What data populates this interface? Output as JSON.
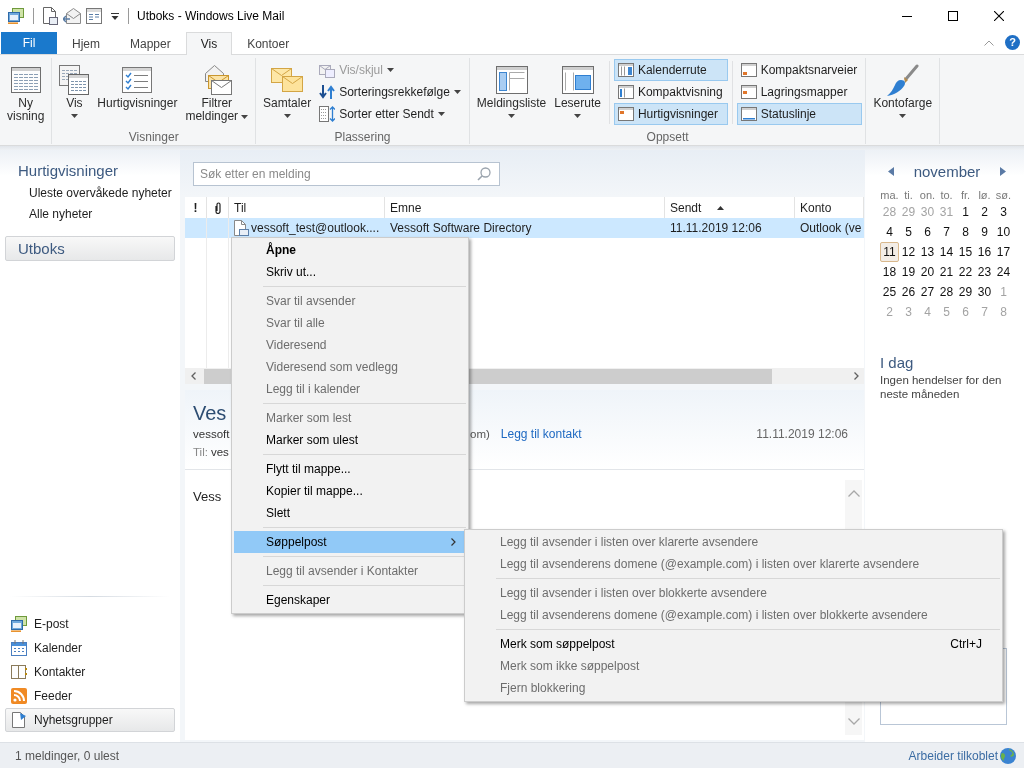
{
  "title_bar": {
    "title": "Utboks - Windows Live Mail"
  },
  "ribbon": {
    "tabs": [
      {
        "label": "Fil",
        "kind": "file",
        "selected": false
      },
      {
        "label": "Hjem",
        "kind": "tab",
        "selected": false
      },
      {
        "label": "Mapper",
        "kind": "tab",
        "selected": false
      },
      {
        "label": "Vis",
        "kind": "tab",
        "selected": true
      },
      {
        "label": "Kontoer",
        "kind": "tab",
        "selected": false
      }
    ],
    "help": "?",
    "groups": [
      {
        "buttons": [
          {
            "label": "Ny visning",
            "dropdown": false
          }
        ]
      },
      {
        "label": "Visninger",
        "buttons": [
          {
            "label": "Vis",
            "dropdown": true
          },
          {
            "label": "Hurtigvisninger",
            "dropdown": false
          },
          {
            "label": "Filtrer meldinger",
            "dropdown": true
          }
        ]
      },
      {
        "label": "Plassering",
        "buttons": [
          {
            "label": "Samtaler",
            "dropdown": true
          }
        ],
        "columns": [
          {
            "kind": "commands",
            "items": [
              {
                "label": "Vis/skjul",
                "dropdown": true,
                "disabled": true
              },
              {
                "label": "Sorteringsrekkefølge",
                "dropdown": true,
                "disabled": false
              },
              {
                "label": "Sorter etter Sendt",
                "dropdown": true,
                "disabled": false
              }
            ]
          }
        ]
      },
      {
        "label": "Oppsett",
        "buttons": [
          {
            "label": "Meldingsliste",
            "dropdown": true
          },
          {
            "label": "Leserute",
            "dropdown": true
          }
        ],
        "columns": [
          {
            "kind": "toggles",
            "items": [
              {
                "label": "Kalenderrute",
                "selected": true
              },
              {
                "label": "Kompaktvisning",
                "selected": false
              },
              {
                "label": "Hurtigvisninger",
                "selected": true
              }
            ]
          },
          {
            "kind": "toggles",
            "items": [
              {
                "label": "Kompaktsnarveier",
                "selected": false
              },
              {
                "label": "Lagringsmapper",
                "selected": false
              },
              {
                "label": "Statuslinje",
                "selected": true
              }
            ]
          }
        ]
      },
      {
        "buttons": [
          {
            "label": "Kontofarge",
            "dropdown": true
          }
        ]
      }
    ]
  },
  "sidebar": {
    "quick_views": {
      "title": "Hurtigvisninger",
      "items": [
        "Uleste overvåkede nyheter",
        "Alle nyheter"
      ]
    },
    "folders": [
      {
        "label": "Utboks",
        "selected": true
      }
    ],
    "nav": [
      {
        "label": "E-post",
        "selected": false
      },
      {
        "label": "Kalender",
        "selected": false
      },
      {
        "label": "Kontakter",
        "selected": false
      },
      {
        "label": "Feeder",
        "selected": false
      },
      {
        "label": "Nyhetsgrupper",
        "selected": true
      }
    ]
  },
  "search": {
    "placeholder": "Søk etter en melding"
  },
  "message_list": {
    "columns": [
      {
        "kind": "flag",
        "label": "!",
        "sorted": false
      },
      {
        "kind": "attachment",
        "sorted": false
      },
      {
        "kind": "text",
        "label": "Til",
        "sorted": false
      },
      {
        "kind": "text",
        "label": "Emne",
        "sorted": false
      },
      {
        "kind": "text",
        "label": "Sendt",
        "sorted": true
      },
      {
        "kind": "text",
        "label": "Konto",
        "sorted": false
      }
    ],
    "rows": [
      {
        "selected": true,
        "to": "vessoft_test@outlook....",
        "subject": "Vessoft Software Directory",
        "sent": "11.11.2019 12:06",
        "account": "Outlook (ve"
      }
    ]
  },
  "preview": {
    "subject": "Ves",
    "from": "vessoft",
    "from_end": "om)",
    "add_contact": "Legg til kontakt",
    "date": "11.11.2019 12:06",
    "to_label": "Til:",
    "to": "ves",
    "body": "Vess"
  },
  "calendar": {
    "month": "november",
    "weekdays": [
      "ma.",
      "ti.",
      "on.",
      "to.",
      "fr.",
      "lø.",
      "sø."
    ],
    "weeks": [
      [
        {
          "day": "28",
          "other_month": true,
          "selected": false
        },
        {
          "day": "29",
          "other_month": true,
          "selected": false
        },
        {
          "day": "30",
          "other_month": true,
          "selected": false
        },
        {
          "day": "31",
          "other_month": true,
          "selected": false
        },
        {
          "day": "1",
          "other_month": false,
          "selected": false
        },
        {
          "day": "2",
          "other_month": false,
          "selected": false
        },
        {
          "day": "3",
          "other_month": false,
          "selected": false
        }
      ],
      [
        {
          "day": "4",
          "other_month": false,
          "selected": false
        },
        {
          "day": "5",
          "other_month": false,
          "selected": false
        },
        {
          "day": "6",
          "other_month": false,
          "selected": false
        },
        {
          "day": "7",
          "other_month": false,
          "selected": false
        },
        {
          "day": "8",
          "other_month": false,
          "selected": false
        },
        {
          "day": "9",
          "other_month": false,
          "selected": false
        },
        {
          "day": "10",
          "other_month": false,
          "selected": false
        }
      ],
      [
        {
          "day": "11",
          "other_month": false,
          "selected": true
        },
        {
          "day": "12",
          "other_month": false,
          "selected": false
        },
        {
          "day": "13",
          "other_month": false,
          "selected": false
        },
        {
          "day": "14",
          "other_month": false,
          "selected": false
        },
        {
          "day": "15",
          "other_month": false,
          "selected": false
        },
        {
          "day": "16",
          "other_month": false,
          "selected": false
        },
        {
          "day": "17",
          "other_month": false,
          "selected": false
        }
      ],
      [
        {
          "day": "18",
          "other_month": false,
          "selected": false
        },
        {
          "day": "19",
          "other_month": false,
          "selected": false
        },
        {
          "day": "20",
          "other_month": false,
          "selected": false
        },
        {
          "day": "21",
          "other_month": false,
          "selected": false
        },
        {
          "day": "22",
          "other_month": false,
          "selected": false
        },
        {
          "day": "23",
          "other_month": false,
          "selected": false
        },
        {
          "day": "24",
          "other_month": false,
          "selected": false
        }
      ],
      [
        {
          "day": "25",
          "other_month": false,
          "selected": false
        },
        {
          "day": "26",
          "other_month": false,
          "selected": false
        },
        {
          "day": "27",
          "other_month": false,
          "selected": false
        },
        {
          "day": "28",
          "other_month": false,
          "selected": false
        },
        {
          "day": "29",
          "other_month": false,
          "selected": false
        },
        {
          "day": "30",
          "other_month": false,
          "selected": false
        },
        {
          "day": "1",
          "other_month": true,
          "selected": false
        }
      ],
      [
        {
          "day": "2",
          "other_month": true,
          "selected": false
        },
        {
          "day": "3",
          "other_month": true,
          "selected": false
        },
        {
          "day": "4",
          "other_month": true,
          "selected": false
        },
        {
          "day": "5",
          "other_month": true,
          "selected": false
        },
        {
          "day": "6",
          "other_month": true,
          "selected": false
        },
        {
          "day": "7",
          "other_month": true,
          "selected": false
        },
        {
          "day": "8",
          "other_month": true,
          "selected": false
        }
      ]
    ]
  },
  "today": {
    "title": "I dag",
    "text": "Ingen hendelser for den neste måneden"
  },
  "status_bar": {
    "messages": "1 meldinger, 0 ulest",
    "connection": "Arbeider tilkoblet"
  },
  "context_menu": {
    "items": [
      {
        "kind": "item",
        "label": "Åpne",
        "default": true,
        "disabled": false,
        "selected": false
      },
      {
        "kind": "item",
        "label": "Skriv ut...",
        "default": false,
        "disabled": false,
        "selected": false
      },
      {
        "kind": "separator"
      },
      {
        "kind": "item",
        "label": "Svar til avsender",
        "default": false,
        "disabled": true,
        "selected": false
      },
      {
        "kind": "item",
        "label": "Svar til alle",
        "default": false,
        "disabled": true,
        "selected": false
      },
      {
        "kind": "item",
        "label": "Videresend",
        "default": false,
        "disabled": true,
        "selected": false
      },
      {
        "kind": "item",
        "label": "Videresend som vedlegg",
        "default": false,
        "disabled": true,
        "selected": false
      },
      {
        "kind": "item",
        "label": "Legg til i kalender",
        "default": false,
        "disabled": true,
        "selected": false
      },
      {
        "kind": "separator"
      },
      {
        "kind": "item",
        "label": "Marker som lest",
        "default": false,
        "disabled": true,
        "selected": false
      },
      {
        "kind": "item",
        "label": "Marker som ulest",
        "default": false,
        "disabled": false,
        "selected": false
      },
      {
        "kind": "separator"
      },
      {
        "kind": "item",
        "label": "Flytt til mappe...",
        "default": false,
        "disabled": false,
        "selected": false
      },
      {
        "kind": "item",
        "label": "Kopier til mappe...",
        "default": false,
        "disabled": false,
        "selected": false
      },
      {
        "kind": "item",
        "label": "Slett",
        "default": false,
        "disabled": false,
        "selected": false
      },
      {
        "kind": "separator"
      },
      {
        "kind": "submenu",
        "label": "Søppelpost",
        "default": false,
        "disabled": false,
        "selected": true,
        "submenu": [
          {
            "kind": "item",
            "label": "Legg til avsender i listen over klarerte avsendere",
            "disabled": true
          },
          {
            "kind": "item",
            "label": "Legg til avsenderens domene (@example.com) i listen over klarerte avsendere",
            "disabled": true
          },
          {
            "kind": "separator"
          },
          {
            "kind": "item",
            "label": "Legg til avsender i listen over blokkerte avsendere",
            "disabled": true
          },
          {
            "kind": "item",
            "label": "Legg til avsenderens domene (@example.com) i listen over blokkerte avsendere",
            "disabled": true
          },
          {
            "kind": "separator"
          },
          {
            "kind": "item",
            "label": "Merk som søppelpost",
            "shortcut": "Ctrl+J",
            "disabled": false
          },
          {
            "kind": "item",
            "label": "Merk som ikke søppelpost",
            "disabled": true
          },
          {
            "kind": "item",
            "label": "Fjern blokkering",
            "disabled": true
          }
        ]
      },
      {
        "kind": "separator"
      },
      {
        "kind": "item",
        "label": "Legg til avsender i Kontakter",
        "default": false,
        "disabled": true,
        "selected": false
      },
      {
        "kind": "separator"
      },
      {
        "kind": "item",
        "label": "Egenskaper",
        "default": false,
        "disabled": false,
        "selected": false
      }
    ]
  }
}
